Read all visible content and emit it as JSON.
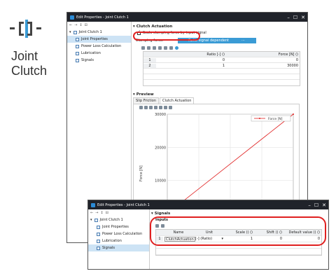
{
  "logo": {
    "line1": "Joint",
    "line2": "Clutch"
  },
  "main_window": {
    "title": "Edit Properties - Joint Clutch 1",
    "tree": [
      {
        "label": "Joint Clutch 1",
        "selected": false
      },
      {
        "label": "Joint Properties",
        "selected": true
      },
      {
        "label": "Power Loss Calculation",
        "selected": false
      },
      {
        "label": "Lubrication",
        "selected": false
      },
      {
        "label": "Signals",
        "selected": false
      }
    ],
    "clutch_section": "Clutch Actuation",
    "checkbox_label": "Scale clamping force by input signal",
    "clamping_label": "Clamping force:",
    "mode_button": "Ratio signal dependent",
    "table_headers": [
      "",
      "Ratio [-] ()",
      "Force [N] ()"
    ],
    "table_rows": [
      [
        "1",
        "0",
        "0"
      ],
      [
        "2",
        "1",
        "30000"
      ]
    ],
    "preview_section": "Preview",
    "tabs": [
      "Slip Friction",
      "Clutch Actuation"
    ],
    "chart": {
      "y_ticks": [
        "30000",
        "20000",
        "10000"
      ],
      "ylabel": "Force [N]",
      "legend": "Force [N]"
    },
    "accent": "#3a9bd5",
    "highlight": "#e02020"
  },
  "signals_window": {
    "title": "Edit Properties - Joint Clutch 1",
    "tree": [
      {
        "label": "Joint Clutch 1",
        "selected": false
      },
      {
        "label": "Joint Properties",
        "selected": false
      },
      {
        "label": "Power Loss Calculation",
        "selected": false
      },
      {
        "label": "Lubrication",
        "selected": false
      },
      {
        "label": "Signals",
        "selected": true
      }
    ],
    "section": "Signals",
    "subsection": "Inputs",
    "headers": [
      "",
      "Name",
      "Unit",
      "Scale () ()",
      "Shift () ()",
      "Default value () ()"
    ],
    "row": {
      "index": "1",
      "name": "ClutchActuation",
      "unit": "[-] (Ratio)",
      "scale": "1",
      "shift": "0",
      "default": "0"
    }
  },
  "chart_data": {
    "type": "line",
    "title": "",
    "xlabel": "",
    "ylabel": "Force [N]",
    "ylim": [
      0,
      30000
    ],
    "series": [
      {
        "name": "Force [N]",
        "x": [
          0,
          1
        ],
        "y": [
          0,
          30000
        ]
      }
    ]
  }
}
